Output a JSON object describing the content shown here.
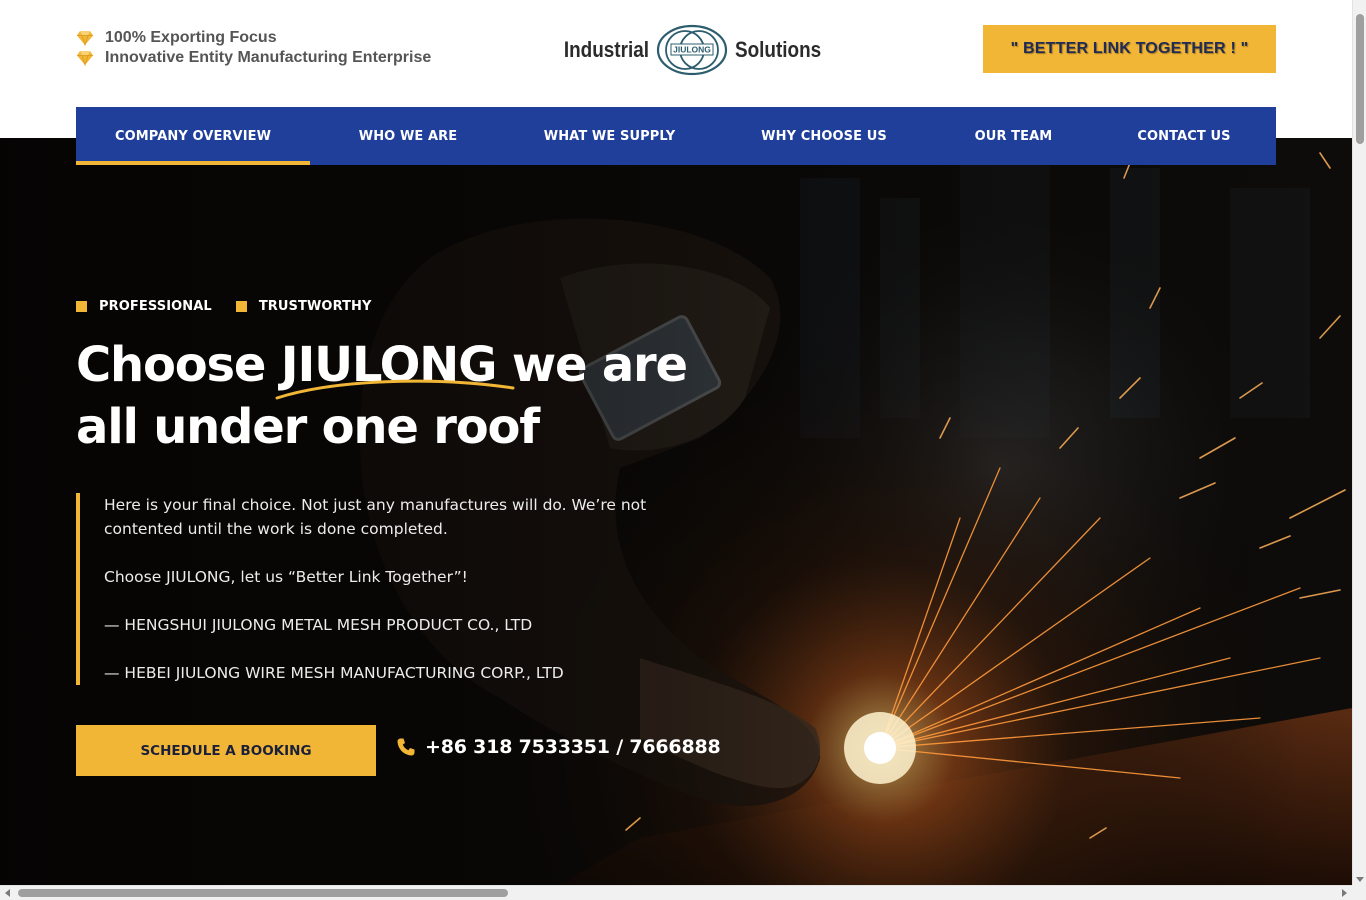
{
  "header": {
    "taglines": [
      {
        "icon": "diamond-icon",
        "text": "100% Exporting Focus"
      },
      {
        "icon": "diamond-icon",
        "text": "Innovative Entity Manufacturing Enterprise"
      }
    ],
    "logo": {
      "left_word": "Industrial",
      "emblem_text": "JIULONG",
      "right_word": "Solutions"
    },
    "cta_label": "\" BETTER LINK TOGETHER ! \""
  },
  "nav": {
    "items": [
      {
        "label": "COMPANY OVERVIEW",
        "active": true
      },
      {
        "label": "WHO WE ARE",
        "active": false
      },
      {
        "label": "WHAT WE SUPPLY",
        "active": false
      },
      {
        "label": "WHY CHOOSE US",
        "active": false
      },
      {
        "label": "OUR TEAM",
        "active": false
      },
      {
        "label": "CONTACT US",
        "active": false
      }
    ]
  },
  "hero": {
    "badges": [
      "PROFESSIONAL",
      "TRUSTWORTHY"
    ],
    "headline": {
      "before": "Choose ",
      "brand": "JIULONG",
      "after_line1": " we are",
      "line2": "all under one roof"
    },
    "quote": {
      "intro": "Here is your final choice. Not just any manufactures will do. We’re not contented until the work is done completed.",
      "slogan": "Choose JIULONG, let us “Better Link Together”!",
      "company1": "— HENGSHUI JIULONG METAL MESH PRODUCT CO., LTD",
      "company2": "— HEBEI JIULONG WIRE MESH MANUFACTURING CORP., LTD"
    },
    "booking_button": "SCHEDULE A BOOKING",
    "phone": {
      "icon": "phone-icon",
      "number": "+86 318 7533351 / 7666888"
    }
  },
  "colors": {
    "accent": "#f2b636",
    "nav_blue": "#1f3f9a",
    "hero_dark": "#0b0907",
    "text_dark": "#555555"
  }
}
